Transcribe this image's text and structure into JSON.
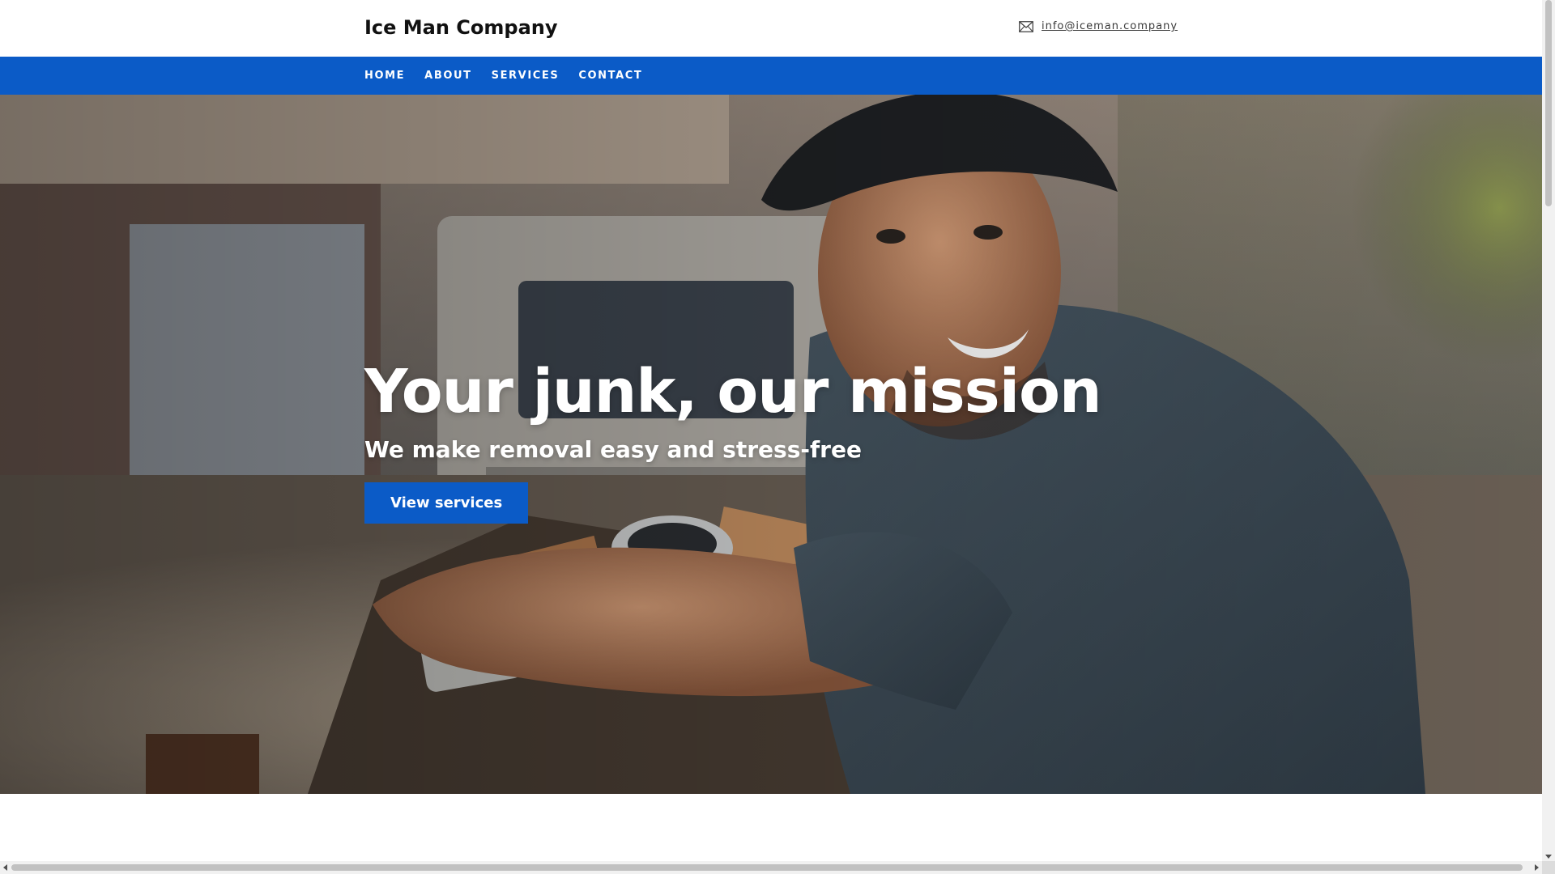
{
  "header": {
    "brand": "Ice Man Company",
    "email": "info@iceman.company",
    "email_icon": "envelope-icon"
  },
  "nav": {
    "items": [
      {
        "label": "HOME"
      },
      {
        "label": "ABOUT"
      },
      {
        "label": "SERVICES"
      },
      {
        "label": "CONTACT"
      }
    ]
  },
  "hero": {
    "title": "Your junk, our mission",
    "subtitle": "We make removal easy and stress-free",
    "cta_label": "View services",
    "image": "smiling-worker-with-junk-photo"
  },
  "colors": {
    "accent": "#0b5bc7",
    "brand_text": "#111111"
  }
}
